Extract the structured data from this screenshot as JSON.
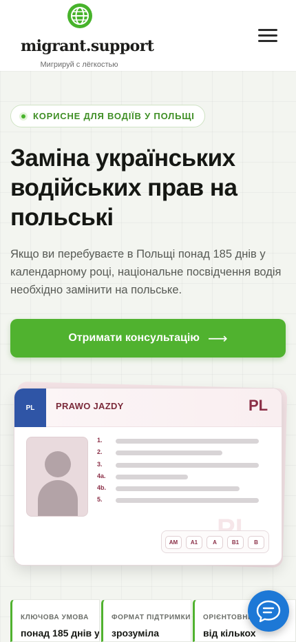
{
  "header": {
    "brand": "migrant.support",
    "tagline": "Мигрируй с лёгкостью",
    "logo_icon": "globe-icon",
    "menu_icon": "hamburger-menu-icon",
    "accent_color": "#47b32b"
  },
  "hero": {
    "badge": "КОРИСНЕ ДЛЯ ВОДІЇВ У ПОЛЬЩІ",
    "title": "Заміна українських водійських прав на польські",
    "description": "Якщо ви перебуваєте в Польщі понад 185 днів у календарному році, національне посвідчення водія необхідно замінити на польське.",
    "cta_label": "Отримати консультацію",
    "cta_arrow": "⟶",
    "cta_color": "#50b22f"
  },
  "license_card": {
    "country_box": "PL",
    "heading": "PRAWO JAZDY",
    "country_big": "PL",
    "watermark": "PL",
    "fields": [
      "1.",
      "2.",
      "3.",
      "4a.",
      "4b.",
      "5."
    ],
    "categories": [
      "AM",
      "A1",
      "A",
      "B1",
      "B"
    ]
  },
  "stats": [
    {
      "label": "КЛЮЧОВА УМОВА",
      "value": "понад 185 днів у"
    },
    {
      "label": "ФОРМАТ ПІДТРИМКИ",
      "value": "зрозуміла"
    },
    {
      "label": "ОРІЄНТОВНИЙ",
      "value": "від кількох"
    }
  ],
  "chat": {
    "icon": "chat-bubble-icon",
    "color": "#1d78d6"
  }
}
